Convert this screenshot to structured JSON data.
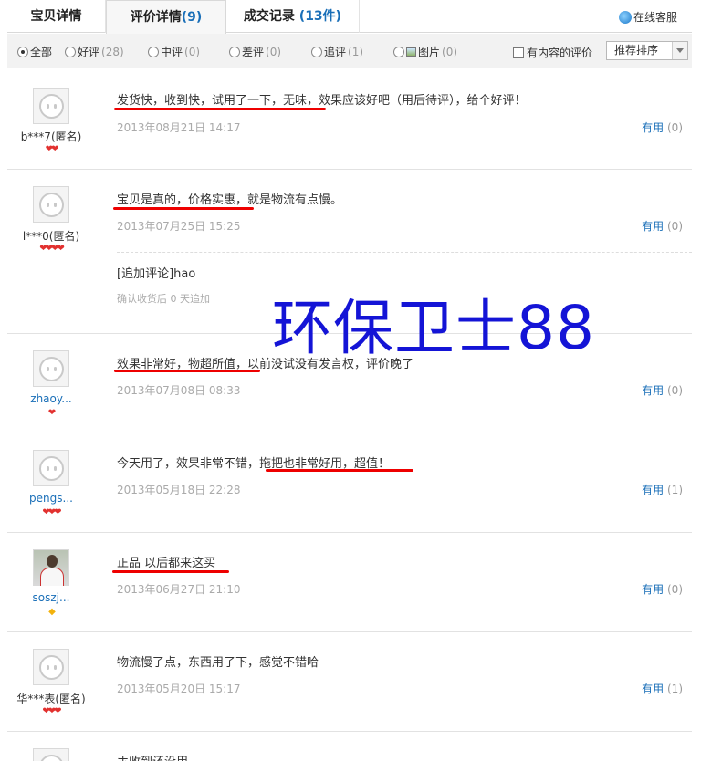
{
  "tabs": [
    {
      "label": "宝贝详情",
      "count": ""
    },
    {
      "label": "评价详情",
      "count": "(9)"
    },
    {
      "label": "成交记录",
      "count": "(13件)"
    }
  ],
  "online_service": "在线客服",
  "filters": {
    "all": "全部",
    "good": "好评",
    "good_n": "(28)",
    "mid": "中评",
    "mid_n": "(0)",
    "bad": "差评",
    "bad_n": "(0)",
    "follow": "追评",
    "follow_n": "(1)",
    "pic": "图片",
    "pic_n": "(0)",
    "has_content": "有内容的评价",
    "sort": "推荐排序"
  },
  "useful_label": "有用",
  "reviews": [
    {
      "user": "b***7(匿名)",
      "rank": "❤❤",
      "content": "发货快，收到快，试用了一下，无味，效果应该好吧（用后待评），给个好评！",
      "date": "2013年08月21日 14:17",
      "useful": "(0)"
    },
    {
      "user": "l***0(匿名)",
      "rank": "❤❤❤❤",
      "content": "宝贝是真的，价格实惠，就是物流有点慢。",
      "date": "2013年07月25日 15:25",
      "useful": "(0)",
      "append": "[追加评论]hao",
      "append_note": "确认收货后 0 天追加"
    },
    {
      "user": "zhaoy...",
      "rank": "❤",
      "content": "效果非常好，物超所值，以前没试没有发言权，评价晚了",
      "date": "2013年07月08日 08:33",
      "useful": "(0)"
    },
    {
      "user": "pengs...",
      "rank": "❤❤❤",
      "content": "今天用了，效果非常不错，拖把也非常好用，超值！",
      "date": "2013年05月18日 22:28",
      "useful": "(1)"
    },
    {
      "user": "soszj...",
      "rank": "◆",
      "content": "正品 以后都来这买",
      "date": "2013年06月27日 21:10",
      "useful": "(0)"
    },
    {
      "user": "华***表(匿名)",
      "rank": "❤❤❤",
      "content": "物流慢了点，东西用了下，感觉不错哈",
      "date": "2013年05月20日 15:17",
      "useful": "(1)"
    },
    {
      "content": "ホ收到还没用"
    }
  ],
  "watermark": "环保卫士88",
  "colors": {
    "link": "#1a6fb8",
    "underline": "#e00000",
    "watermark": "#1414d6"
  }
}
